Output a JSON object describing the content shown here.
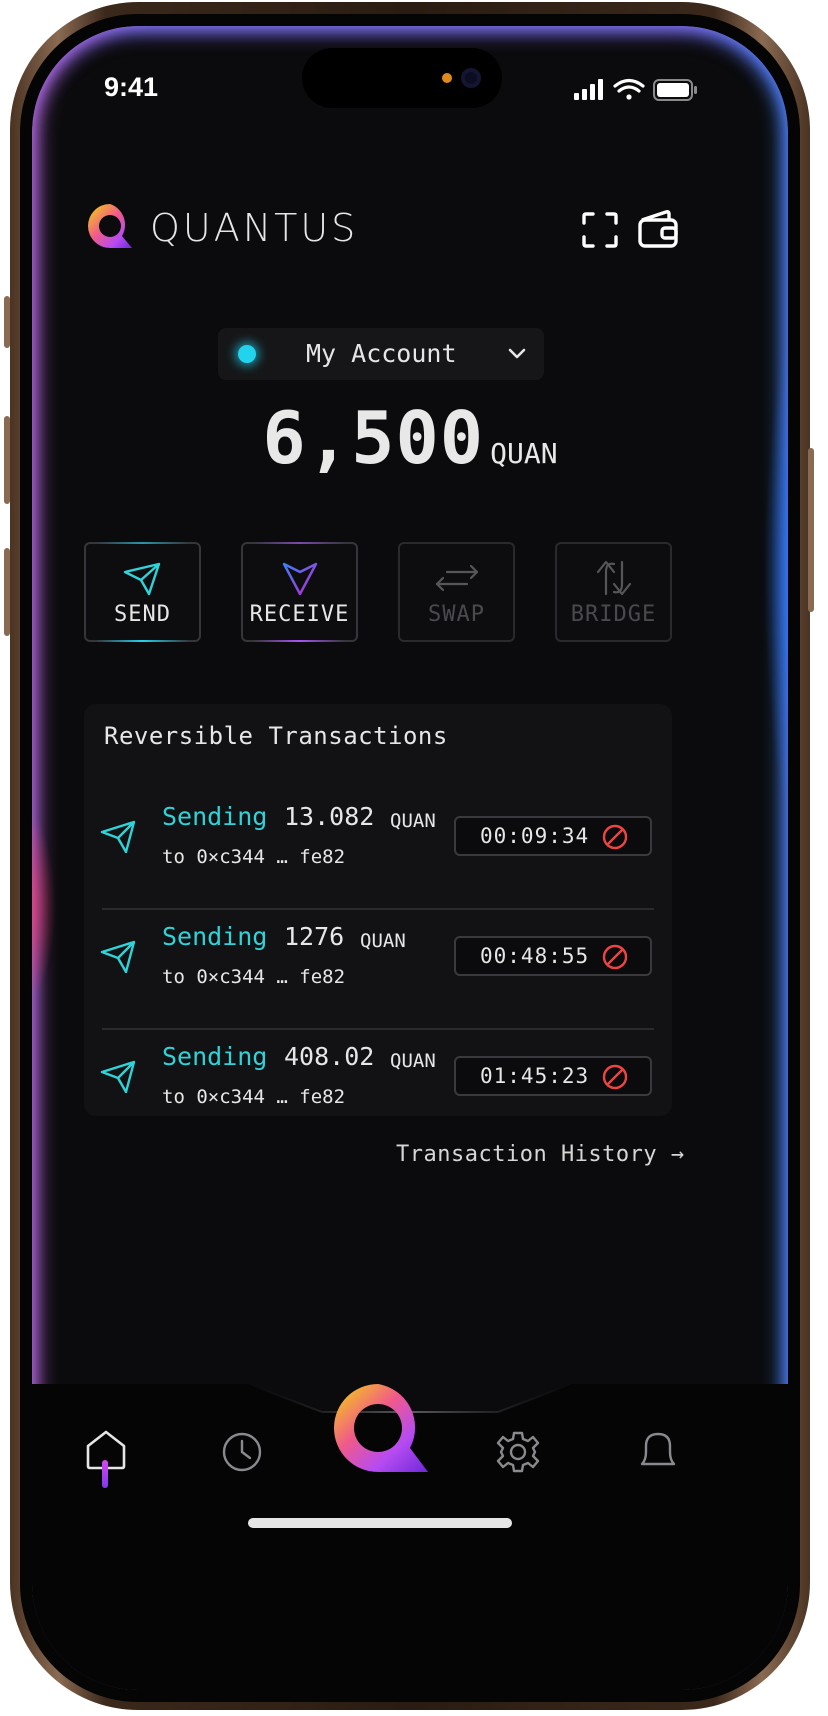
{
  "status_bar": {
    "time": "9:41",
    "icons": [
      "signal-icon",
      "wifi-icon",
      "battery-icon"
    ]
  },
  "header": {
    "brand": "QUANTUS",
    "icons": [
      "scan-icon",
      "wallet-icon"
    ]
  },
  "account": {
    "name": "My Account",
    "status_color": "#22d3ee"
  },
  "balance": {
    "amount": "6,500",
    "unit": "QUAN"
  },
  "actions": [
    {
      "label": "SEND",
      "state": "enabled",
      "accent": "#22d3ee"
    },
    {
      "label": "RECEIVE",
      "state": "enabled",
      "accent": "#a855f7"
    },
    {
      "label": "SWAP",
      "state": "disabled"
    },
    {
      "label": "BRIDGE",
      "state": "disabled"
    }
  ],
  "reversible": {
    "title": "Reversible Transactions",
    "transactions": [
      {
        "verb": "Sending",
        "amount": "13.082",
        "unit": "QUAN",
        "to": "to 0×c344 … fe82",
        "timer": "00:09:34"
      },
      {
        "verb": "Sending",
        "amount": "1276",
        "unit": "QUAN",
        "to": "to 0×c344 … fe82",
        "timer": "00:48:55"
      },
      {
        "verb": "Sending",
        "amount": "408.02",
        "unit": "QUAN",
        "to": "to 0×c344 … fe82",
        "timer": "01:45:23"
      }
    ]
  },
  "history_link": "Transaction History →",
  "nav": {
    "items": [
      "home-icon",
      "history-icon",
      "quantus-logo",
      "settings-icon",
      "notifications-icon"
    ],
    "active": "home-icon"
  },
  "colors": {
    "background": "#0b0b0d",
    "accent_teal": "#2fd3d8",
    "accent_purple": "#a855f7",
    "cancel_red": "#ef4444"
  }
}
